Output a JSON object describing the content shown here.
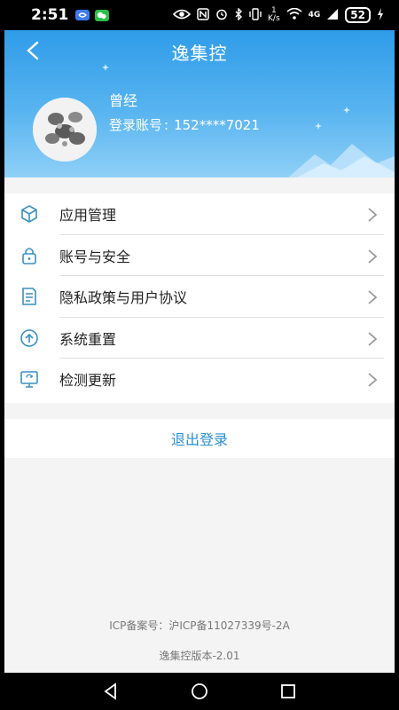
{
  "status_bar": {
    "time": "2:51",
    "net_speed_value": "1",
    "net_speed_unit": "K/s",
    "network": "4G",
    "battery": "52"
  },
  "header": {
    "title": "逸集控",
    "user_name": "曾经",
    "account_label": "登录账号",
    "account_sep": ":",
    "account_value": "152****7021"
  },
  "menu": {
    "items": [
      {
        "label": "应用管理",
        "icon": "cube-icon"
      },
      {
        "label": "账号与安全",
        "icon": "lock-icon"
      },
      {
        "label": "隐私政策与用户协议",
        "icon": "document-icon"
      },
      {
        "label": "系统重置",
        "icon": "arrow-up-circle-icon"
      },
      {
        "label": "检测更新",
        "icon": "monitor-refresh-icon"
      }
    ]
  },
  "logout_label": "退出登录",
  "footer": {
    "icp": "ICP备案号：沪ICP备11027339号-2A",
    "version": "逸集控版本-2.01"
  },
  "colors": {
    "header_top": "#2f9ce9",
    "header_bottom": "#8fd0f7",
    "accent": "#2b8fcf",
    "icon": "#3a8fc4"
  }
}
